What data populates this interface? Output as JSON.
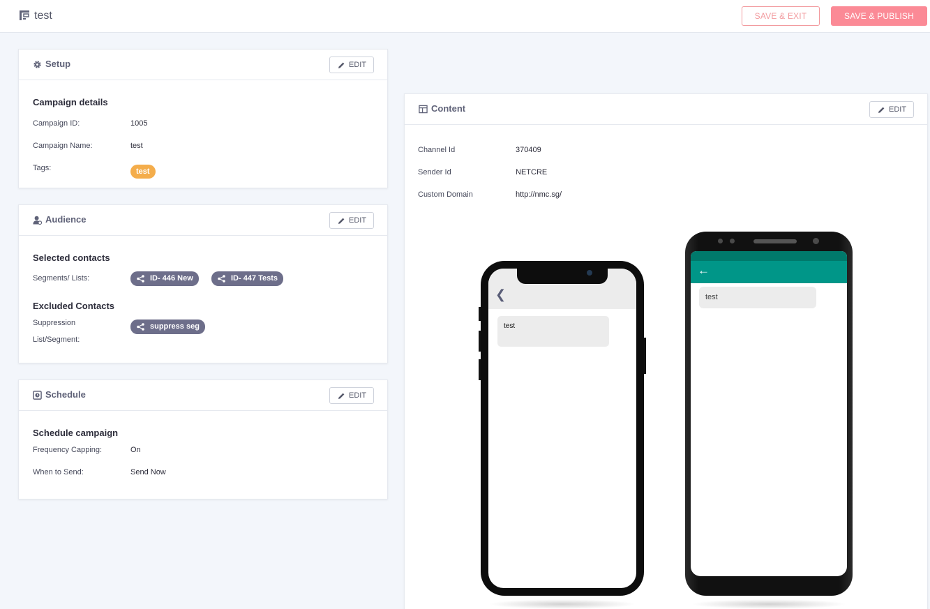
{
  "header": {
    "title": "test",
    "save_exit_label": "SAVE & EXIT",
    "save_publish_label": "SAVE & PUBLISH"
  },
  "colors": {
    "accent": "#fb8a96",
    "tag": "#f4ad4b",
    "chip": "#6d6e8a",
    "android_bar": "#009688"
  },
  "setup": {
    "title": "Setup",
    "edit_label": "EDIT",
    "section_title": "Campaign details",
    "campaign_id_label": "Campaign ID:",
    "campaign_id": "1005",
    "campaign_name_label": "Campaign Name:",
    "campaign_name": "test",
    "tags_label": "Tags:",
    "tags": [
      "test"
    ]
  },
  "audience": {
    "title": "Audience",
    "edit_label": "EDIT",
    "selected_title": "Selected contacts",
    "segments_label": "Segments/ Lists:",
    "segments": [
      "ID- 446 New",
      "ID- 447 Tests"
    ],
    "excluded_title": "Excluded Contacts",
    "suppression_label_1": "Suppression",
    "suppression_label_2": "List/Segment:",
    "suppression": [
      "suppress seg"
    ]
  },
  "schedule": {
    "title": "Schedule",
    "edit_label": "EDIT",
    "section_title": "Schedule campaign",
    "frequency_label": "Frequency Capping:",
    "frequency": "On",
    "when_label": "When to Send:",
    "when": "Send Now"
  },
  "content": {
    "title": "Content",
    "edit_label": "EDIT",
    "channel_label": "Channel Id",
    "channel": "370409",
    "sender_label": "Sender Id",
    "sender": "NETCRE",
    "domain_label": "Custom Domain",
    "domain": "http://nmc.sg/",
    "preview_message": "test"
  },
  "icons": {
    "app": "campaign-icon",
    "setup": "gear-icon",
    "audience": "user-icon",
    "schedule": "clock-icon",
    "content": "layout-icon",
    "edit": "pencil-icon",
    "segment": "share-icon",
    "back": "back-arrow-icon"
  }
}
